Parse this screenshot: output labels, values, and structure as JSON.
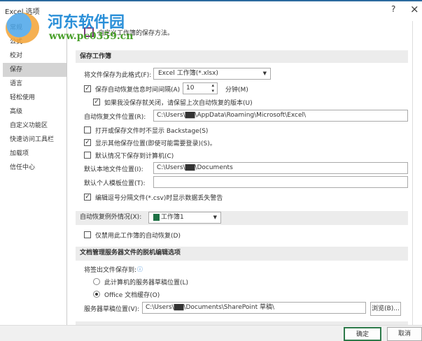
{
  "window": {
    "title": "Excel 选项",
    "help": "?",
    "close": "×"
  },
  "sidebar": {
    "items": [
      {
        "label": "常规"
      },
      {
        "label": "公式"
      },
      {
        "label": "校对"
      },
      {
        "label": "保存"
      },
      {
        "label": "语言"
      },
      {
        "label": "轻松使用"
      },
      {
        "label": "高级"
      },
      {
        "label": "自定义功能区"
      },
      {
        "label": "快速访问工具栏"
      },
      {
        "label": "加载项"
      },
      {
        "label": "信任中心"
      }
    ],
    "selected": "保存"
  },
  "header": {
    "text": "自定义工作簿的保存方法。"
  },
  "save_workbook": {
    "title": "保存工作簿",
    "format_label": "将文件保存为此格式(F):",
    "format_value": "Excel 工作簿(*.xlsx)",
    "autorecover_label": "保存自动恢复信息时间间隔(A)",
    "autorecover_checked": true,
    "interval": "10",
    "interval_unit": "分钟(M)",
    "keep_last_label": "如果我没保存就关闭，请保留上次自动恢复的版本(U)",
    "keep_last_checked": true,
    "autorecover_location_label": "自动恢复文件位置(R):",
    "autorecover_location": "C:\\Users\\▇▇\\AppData\\Roaming\\Microsoft\\Excel\\",
    "no_backstage_label": "打开或保存文件时不显示 Backstage(S)",
    "no_backstage_checked": false,
    "show_other_label": "显示其他保存位置(即使可能需要登录)(S)。",
    "show_other_checked": true,
    "save_local_label": "默认情况下保存到计算机(C)",
    "save_local_checked": false,
    "default_local_label": "默认本地文件位置(I):",
    "default_local": "C:\\Users\\▇▇\\Documents",
    "template_label": "默认个人模板位置(T):",
    "template_value": "",
    "csv_warning_label": "编辑逗号分隔文件(*.csv)时显示数据丢失警告",
    "csv_warning_checked": true
  },
  "autorecover_exceptions": {
    "title": "自动恢复例外情况(X):",
    "workbook": "工作簿1",
    "disable_label": "仅禁用此工作簿的自动恢复(D)",
    "disable_checked": false
  },
  "offline": {
    "title": "文档管理服务器文件的脱机编辑选项",
    "save_to_label": "将签出文件保存到:",
    "option1": "此计算机的服务器草稿位置(L)",
    "option2": "Office 文档缓存(O)",
    "selected": "option2",
    "drafts_label": "服务器草稿位置(V):",
    "drafts_value": "C:\\Users\\▇▇\\Documents\\SharePoint 草稿\\",
    "browse": "浏览(B)..."
  },
  "footer": {
    "ok": "确定",
    "cancel": "取消"
  },
  "watermark": {
    "name": "河东软件园",
    "url": "www.pc0359.cn"
  }
}
